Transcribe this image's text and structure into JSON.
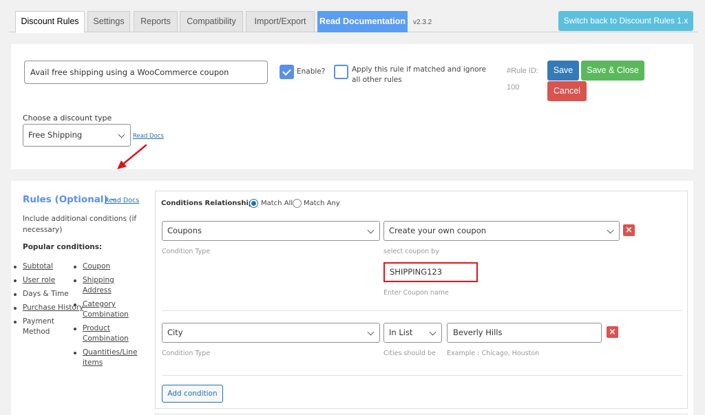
{
  "tabs": [
    {
      "label": "Discount Rules",
      "active": true
    },
    {
      "label": "Settings",
      "active": false
    },
    {
      "label": "Reports",
      "active": false
    },
    {
      "label": "Compatibility",
      "active": false
    },
    {
      "label": "Import/Export",
      "active": false
    },
    {
      "label": "Read Documentation",
      "active": false
    }
  ],
  "version": "v2.3.2",
  "switch_back_label": "Switch back to Discount Rules 1.x",
  "rule": {
    "title_value": "Avail free shipping using a WooCommerce coupon",
    "enable_label": "Enable?",
    "enable_checked": true,
    "apply_exclusive_label": "Apply this rule if matched and ignore all other rules",
    "apply_exclusive_checked": false,
    "rule_id_label": "#Rule ID:",
    "rule_id_value": "100",
    "save_label": "Save",
    "save_close_label": "Save & Close",
    "cancel_label": "Cancel",
    "discount_type_label": "Choose a discount type",
    "discount_type_value": "Free Shipping",
    "read_docs_label": "Read Docs"
  },
  "rules_section": {
    "title": "Rules (Optional)",
    "separator": "-",
    "read_docs_label": "Read Docs",
    "description": "Include additional conditions (if necessary)",
    "popular_label": "Popular conditions:",
    "popular_left": [
      {
        "label": "Subtotal",
        "link": true
      },
      {
        "label": "User role",
        "link": true
      },
      {
        "label": "Days & Time",
        "link": false
      },
      {
        "label": "Purchase History",
        "link": true
      },
      {
        "label": "Payment Method",
        "link": false
      }
    ],
    "popular_right": [
      {
        "label": "Coupon",
        "link": true
      },
      {
        "label": "Shipping Address",
        "link": true
      },
      {
        "label": "Category Combination",
        "link": true
      },
      {
        "label": "Product Combination",
        "link": true
      },
      {
        "label": "Quantities/Line items",
        "link": true
      }
    ]
  },
  "conditions": {
    "relationship_label": "Conditions Relationship",
    "match_all_label": "Match All",
    "match_any_label": "Match Any",
    "selected": "Match All",
    "items": [
      {
        "type_value": "Coupons",
        "type_helper": "Condition Type",
        "operator_value": "Create your own coupon",
        "operator_helper": "select coupon by",
        "value": "SHIPPING123",
        "value_helper": "Enter Coupon name"
      },
      {
        "type_value": "City",
        "type_helper": "Condition Type",
        "operator_value": "In List",
        "operator_helper": "Cities should be",
        "value": "Beverly Hills",
        "value_helper": "Example : Chicago, Houston"
      }
    ],
    "add_label": "Add condition",
    "remove_icon": "×"
  },
  "colors": {
    "primary": "#337ab7",
    "success": "#5cb85c",
    "danger": "#d9534f",
    "info": "#5bc0de",
    "accent": "#5b8fe8",
    "highlight": "#e0131b"
  }
}
